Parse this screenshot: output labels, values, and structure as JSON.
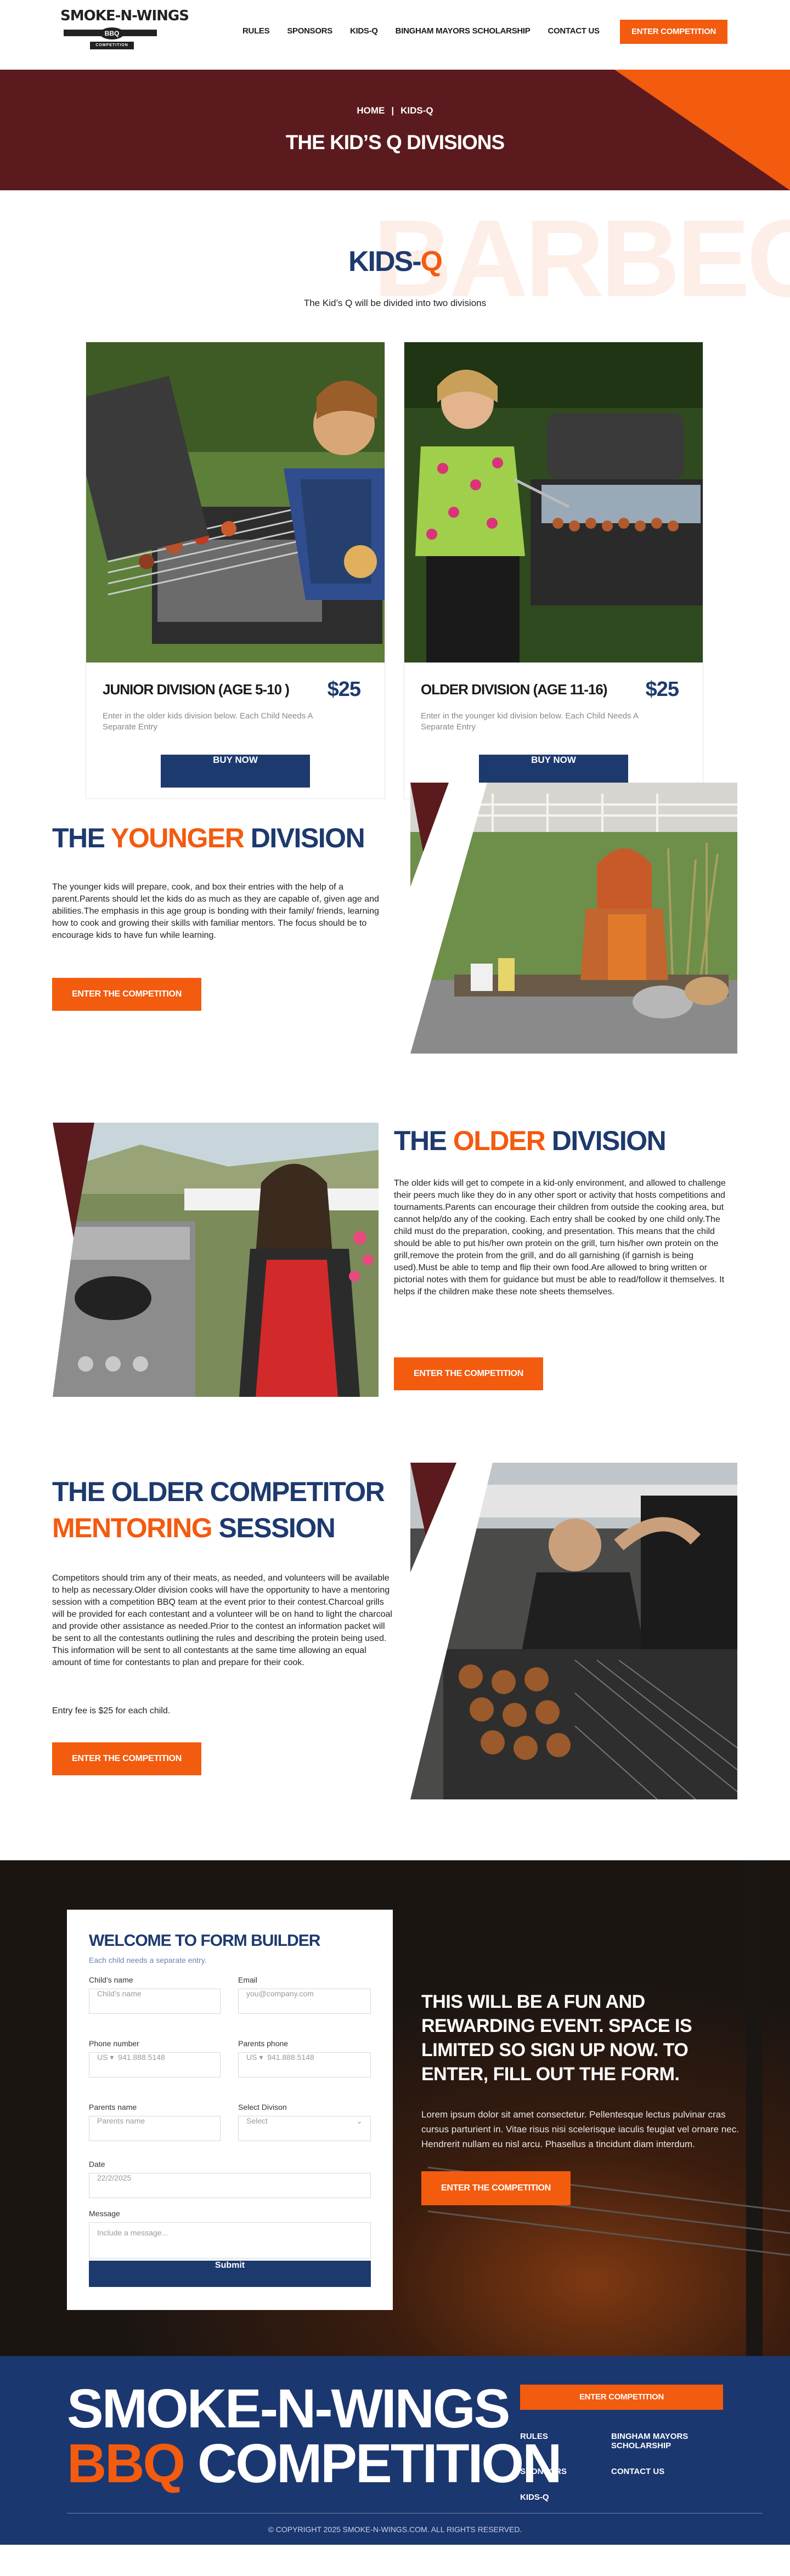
{
  "header": {
    "logo": {
      "line1": "SMOKE-N-WINGS",
      "badge": "BBQ",
      "sub": "COMPETITION"
    },
    "nav": [
      "RULES",
      "SPONSORS",
      "KIDS-Q",
      "BINGHAM MAYORS SCHOLARSHIP",
      "CONTACT US"
    ],
    "cta": "ENTER COMPETITION"
  },
  "hero": {
    "crumb_home": "HOME",
    "crumb_sep": "|",
    "crumb_current": "KIDS-Q",
    "title": "THE KID’S Q DIVISIONS"
  },
  "kids": {
    "watermark": "BARBECUE",
    "title_main": "KIDS-",
    "title_accent": "Q",
    "intro": "The Kid’s Q will be divided into two divisions",
    "cards": [
      {
        "title": "JUNIOR DIVISION (AGE 5-10 )",
        "price": "$25",
        "desc": "Enter in the older kids division below. Each Child Needs A Separate Entry",
        "button": "BUY NOW"
      },
      {
        "title": "OLDER DIVISION (AGE 11-16)",
        "price": "$25",
        "desc": "Enter in the younger kid division below. Each Child Needs A Separate Entry",
        "button": "BUY NOW"
      }
    ]
  },
  "younger": {
    "t1": "THE ",
    "t2": "YOUNGER",
    "t3": " DIVISION",
    "body": "The younger kids will prepare, cook, and box their entries with the help of a parent.Parents should let the kids do as much as they are capable of, given age and abilities.The emphasis in this age group is bonding with their family/ friends, learning how to cook and growing their skills with familiar mentors. The focus should be to encourage kids to have fun while learning.",
    "button": "ENTER THE COMPETITION"
  },
  "older": {
    "t1": "THE ",
    "t2": "OLDER",
    "t3": " DIVISION",
    "body": "The older kids will get to compete in a kid-only environment, and allowed to challenge their peers much like they do in any other sport or activity that hosts competitions and tournaments.Parents can encourage their children from outside the cooking area, but cannot help/do any of the cooking. Each entry shall be cooked by one child only.The child must do the preparation, cooking, and presentation. This means that the child should be able to put his/her own protein on the grill, turn his/her own protein on the grill,remove the protein from the grill, and do all garnishing (if garnish is being used).Must be able to temp and flip their own food.Are allowed to bring written or pictorial notes with them for guidance but must be able to read/follow it themselves. It helps if the children make these note sheets themselves.",
    "button": "ENTER THE COMPETITION"
  },
  "mentoring": {
    "t1": "THE OLDER COMPETITOR",
    "t2": "MENTORING",
    "t3": " SESSION",
    "body": "Competitors should trim any of their meats, as needed, and volunteers will be available to help as necessary.Older division cooks will have the opportunity to have a mentoring session with a competition BBQ team at the event prior to their contest.Charcoal grills will be provided for each contestant and a volunteer will be on hand to light the charcoal and provide other assistance as needed.Prior to the contest an information packet will be sent to all the contestants outlining the rules and describing the protein being used. This information will be sent to all contestants at the same time allowing an equal amount of time for contestants to plan and prepare for their cook.",
    "fee": "Entry fee is $25 for each child.",
    "button": "ENTER THE COMPETITION"
  },
  "form": {
    "title": "WELCOME TO FORM BUILDER",
    "hint": "Each child needs a separate entry.",
    "child_label": "Child’s name",
    "child_ph": "Child’s name",
    "email_label": "Email",
    "email_ph": "you@company.com",
    "phone_label": "Phone number",
    "phone_cc": "US",
    "phone_ph": "941.888.5148",
    "pphone_label": "Parents phone",
    "pphone_cc": "US",
    "pphone_ph": "941.888.5148",
    "pname_label": "Parents name",
    "pname_ph": "Parents name",
    "div_label": "Select Divison",
    "div_ph": "Select",
    "date_label": "Date",
    "date_val": "22/2/2025",
    "msg_label": "Message",
    "msg_ph": "Include a message...",
    "submit": "Submit"
  },
  "promo": {
    "title": "THIS WILL BE A FUN AND REWARDING EVENT. SPACE IS LIMITED SO SIGN UP NOW. TO ENTER, FILL OUT THE FORM.",
    "body": "Lorem ipsum dolor sit amet consectetur. Pellentesque lectus pulvinar cras cursus parturient in. Vitae risus nisi scelerisque iaculis feugiat vel ornare nec. Hendrerit nullam eu nisl arcu. Phasellus a tincidunt diam interdum.",
    "button": "ENTER THE COMPETITION"
  },
  "footer": {
    "line1": "SMOKE-N-WINGS",
    "line2a": "BBQ",
    "line2b": " COMPETITION",
    "cta": "ENTER COMPETITION",
    "links": [
      "RULES",
      "BINGHAM MAYORS SCHOLARSHIP",
      "SPONSORS",
      "CONTACT US",
      "KIDS-Q"
    ],
    "copyright": "© COPYRIGHT 2025 SMOKE-N-WINGS.COM. ALL RIGHTS RESERVED."
  },
  "colors": {
    "navy": "#1d3a6e",
    "orange": "#f35b0f",
    "maroon": "#5b1a1e"
  }
}
